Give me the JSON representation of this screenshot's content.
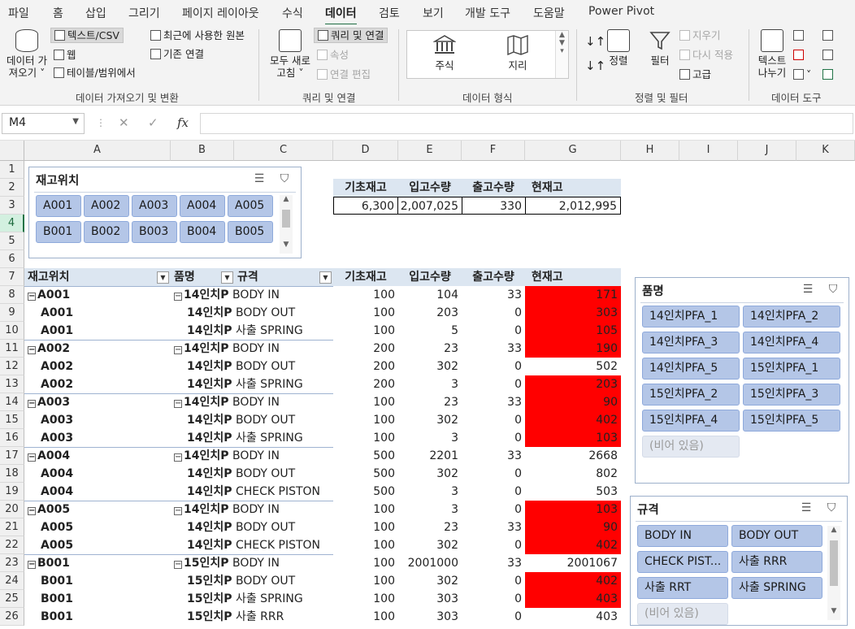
{
  "ribbon_tabs": [
    "파일",
    "홈",
    "삽입",
    "그리기",
    "페이지 레이아웃",
    "수식",
    "데이터",
    "검토",
    "보기",
    "개발 도구",
    "도움말",
    "Power Pivot"
  ],
  "ribbon": {
    "get_data_l1": "데이터 가",
    "get_data_l2": "져오기 ˅",
    "text_csv": "텍스트/CSV",
    "web": "웹",
    "table_range": "테이블/범위에서",
    "recent_sources": "최근에 사용한 원본",
    "existing_conn": "기존 연결",
    "group1": "데이터 가져오기 및 변환",
    "refresh_l1": "모두 새로",
    "refresh_l2": "고침 ˅",
    "queries_conn": "쿼리 및 연결",
    "properties": "속성",
    "edit_links": "연결 편집",
    "group2": "쿼리 및 연결",
    "stocks": "주식",
    "geography": "지리",
    "group3": "데이터 형식",
    "sort": "정렬",
    "filter": "필터",
    "clear": "지우기",
    "reapply": "다시 적용",
    "advanced": "고급",
    "group4": "정렬 및 필터",
    "text_to_cols_l1": "텍스트",
    "text_to_cols_l2": "나누기",
    "group5": "데이터 도구"
  },
  "formula_bar": {
    "name_box": "M4",
    "formula": ""
  },
  "columns": [
    "A",
    "B",
    "C",
    "D",
    "E",
    "F",
    "G",
    "H",
    "I",
    "J",
    "K"
  ],
  "rows": [
    "1",
    "2",
    "3",
    "4",
    "5",
    "6",
    "7",
    "8",
    "9",
    "10",
    "11",
    "12",
    "13",
    "14",
    "15",
    "16",
    "17",
    "18",
    "19",
    "20",
    "21",
    "22",
    "23",
    "24",
    "25",
    "26"
  ],
  "summary": {
    "headers": [
      "기초재고",
      "입고수량",
      "출고수량",
      "현재고"
    ],
    "values": [
      "6,300",
      "2,007,025",
      "330",
      "2,012,995"
    ]
  },
  "pivot": {
    "headers": [
      "재고위치",
      "품명",
      "규격",
      "기초재고",
      "입고수량",
      "출고수량",
      "현재고"
    ],
    "rows": [
      {
        "loc": "A001",
        "item": "14인치P",
        "spec": "BODY IN",
        "base": "100",
        "in": "104",
        "out": "33",
        "cur": "171",
        "red": true,
        "first": true
      },
      {
        "loc": "A001",
        "item": "14인치P",
        "spec": "BODY OUT",
        "base": "100",
        "in": "203",
        "out": "0",
        "cur": "303",
        "red": true,
        "first": false
      },
      {
        "loc": "A001",
        "item": "14인치P",
        "spec": "사출 SPRING",
        "base": "100",
        "in": "5",
        "out": "0",
        "cur": "105",
        "red": true,
        "first": false
      },
      {
        "loc": "A002",
        "item": "14인치P",
        "spec": "BODY IN",
        "base": "200",
        "in": "23",
        "out": "33",
        "cur": "190",
        "red": true,
        "first": true
      },
      {
        "loc": "A002",
        "item": "14인치P",
        "spec": "BODY OUT",
        "base": "200",
        "in": "302",
        "out": "0",
        "cur": "502",
        "red": false,
        "first": false
      },
      {
        "loc": "A002",
        "item": "14인치P",
        "spec": "사출 SPRING",
        "base": "200",
        "in": "3",
        "out": "0",
        "cur": "203",
        "red": true,
        "first": false
      },
      {
        "loc": "A003",
        "item": "14인치P",
        "spec": "BODY IN",
        "base": "100",
        "in": "23",
        "out": "33",
        "cur": "90",
        "red": true,
        "first": true
      },
      {
        "loc": "A003",
        "item": "14인치P",
        "spec": "BODY OUT",
        "base": "100",
        "in": "302",
        "out": "0",
        "cur": "402",
        "red": true,
        "first": false
      },
      {
        "loc": "A003",
        "item": "14인치P",
        "spec": "사출 SPRING",
        "base": "100",
        "in": "3",
        "out": "0",
        "cur": "103",
        "red": true,
        "first": false
      },
      {
        "loc": "A004",
        "item": "14인치P",
        "spec": "BODY IN",
        "base": "500",
        "in": "2201",
        "out": "33",
        "cur": "2668",
        "red": false,
        "first": true
      },
      {
        "loc": "A004",
        "item": "14인치P",
        "spec": "BODY OUT",
        "base": "500",
        "in": "302",
        "out": "0",
        "cur": "802",
        "red": false,
        "first": false
      },
      {
        "loc": "A004",
        "item": "14인치P",
        "spec": "CHECK PISTON",
        "base": "500",
        "in": "3",
        "out": "0",
        "cur": "503",
        "red": false,
        "first": false
      },
      {
        "loc": "A005",
        "item": "14인치P",
        "spec": "BODY IN",
        "base": "100",
        "in": "3",
        "out": "0",
        "cur": "103",
        "red": true,
        "first": true
      },
      {
        "loc": "A005",
        "item": "14인치P",
        "spec": "BODY OUT",
        "base": "100",
        "in": "23",
        "out": "33",
        "cur": "90",
        "red": true,
        "first": false
      },
      {
        "loc": "A005",
        "item": "14인치P",
        "spec": "CHECK PISTON",
        "base": "100",
        "in": "302",
        "out": "0",
        "cur": "402",
        "red": true,
        "first": false
      },
      {
        "loc": "B001",
        "item": "15인치P",
        "spec": "BODY IN",
        "base": "100",
        "in": "2001000",
        "out": "33",
        "cur": "2001067",
        "red": false,
        "first": true
      },
      {
        "loc": "B001",
        "item": "15인치P",
        "spec": "BODY OUT",
        "base": "100",
        "in": "302",
        "out": "0",
        "cur": "402",
        "red": true,
        "first": false
      },
      {
        "loc": "B001",
        "item": "15인치P",
        "spec": "사출 SPRING",
        "base": "100",
        "in": "303",
        "out": "0",
        "cur": "403",
        "red": true,
        "first": false
      },
      {
        "loc": "B001",
        "item": "15인치P",
        "spec": "사출 RRR",
        "base": "100",
        "in": "303",
        "out": "0",
        "cur": "403",
        "red": false,
        "first": false
      }
    ]
  },
  "slicer_location": {
    "title": "재고위치",
    "items": [
      "A001",
      "A002",
      "A003",
      "A004",
      "A005",
      "B001",
      "B002",
      "B003",
      "B004",
      "B005"
    ]
  },
  "slicer_item": {
    "title": "품명",
    "items": [
      "14인치PFA_1",
      "14인치PFA_2",
      "14인치PFA_3",
      "14인치PFA_4",
      "14인치PFA_5",
      "15인치PFA_1",
      "15인치PFA_2",
      "15인치PFA_3",
      "15인치PFA_4",
      "15인치PFA_5"
    ],
    "empty": "(비어 있음)"
  },
  "slicer_spec": {
    "title": "규격",
    "items": [
      "BODY IN",
      "BODY OUT",
      "CHECK PIST...",
      "사출 RRR",
      "사출 RRT",
      "사출 SPRING"
    ],
    "empty": "(비어 있음)"
  },
  "colors": {
    "accent": "#217346",
    "slicer_btn": "#b4c6e7",
    "highlight_red": "#ff0000",
    "header_fill": "#dce6f1"
  }
}
